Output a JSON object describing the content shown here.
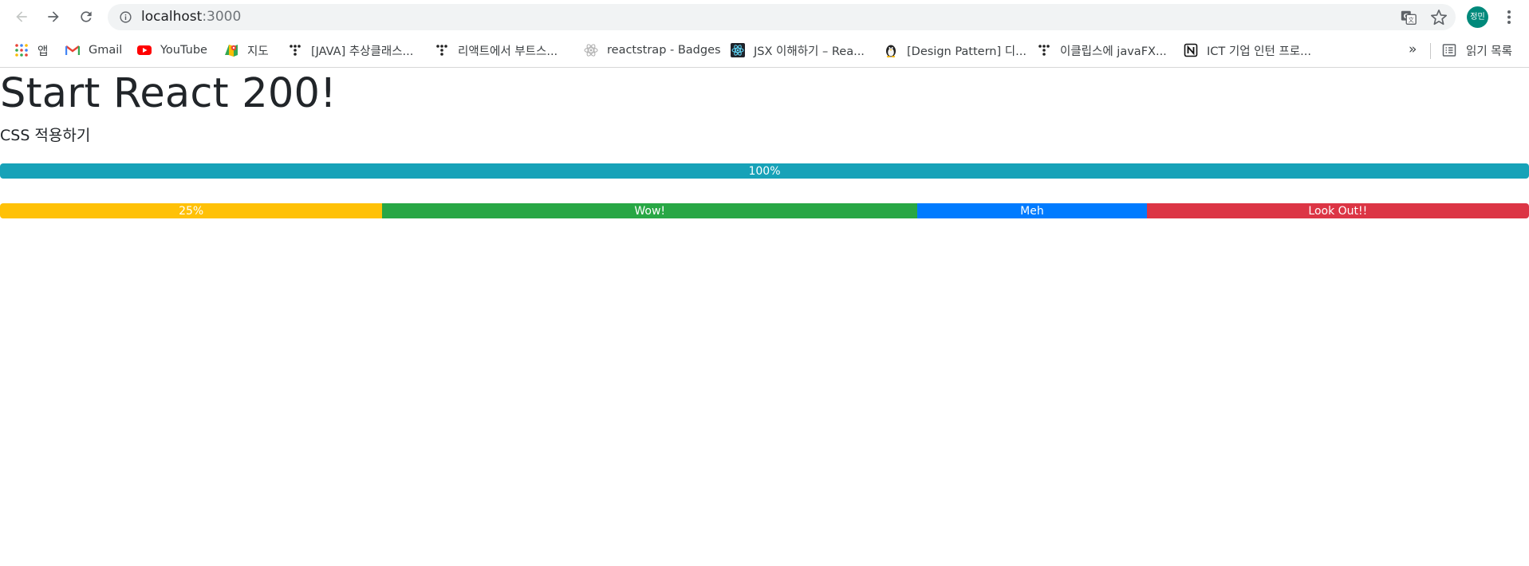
{
  "browser": {
    "url_host": "localhost",
    "url_port": ":3000",
    "avatar_text": "정민",
    "icons": [
      "back-arrow-icon",
      "forward-arrow-icon",
      "reload-icon",
      "info-icon",
      "translate-icon",
      "star-icon",
      "kebab-menu-icon"
    ]
  },
  "bookmarks": {
    "items": [
      {
        "label": "앱",
        "icon": "apps-grid-icon"
      },
      {
        "label": "Gmail",
        "icon": "gmail-icon"
      },
      {
        "label": "YouTube",
        "icon": "youtube-icon"
      },
      {
        "label": "지도",
        "icon": "maps-icon"
      },
      {
        "label": "[JAVA] 추상클래스...",
        "icon": "tistory-icon"
      },
      {
        "label": "리액트에서 부트스...",
        "icon": "tistory-icon"
      },
      {
        "label": "reactstrap - Badges",
        "icon": "react-icon"
      },
      {
        "label": "JSX 이해하기 – Rea...",
        "icon": "react-dark-icon"
      },
      {
        "label": "[Design Pattern] 디...",
        "icon": "penguin-icon"
      },
      {
        "label": "이클립스에 javaFX...",
        "icon": "tistory-icon"
      },
      {
        "label": "ICT 기업 인턴 프로...",
        "icon": "notion-icon"
      }
    ],
    "more_label": "»",
    "reading_list_label": "읽기 목록"
  },
  "page": {
    "title": "Start React 200!",
    "subtitle": "CSS 적용하기",
    "progress_single": {
      "label": "100%",
      "value_percent": 100,
      "color": "#17a2b8"
    },
    "progress_multi": [
      {
        "label": "25%",
        "value_percent": 25,
        "color": "#ffc107"
      },
      {
        "label": "Wow!",
        "value_percent": 35,
        "color": "#28a745"
      },
      {
        "label": "Meh",
        "value_percent": 15,
        "color": "#007bff"
      },
      {
        "label": "Look Out!!",
        "value_percent": 25,
        "color": "#dc3545"
      }
    ]
  }
}
